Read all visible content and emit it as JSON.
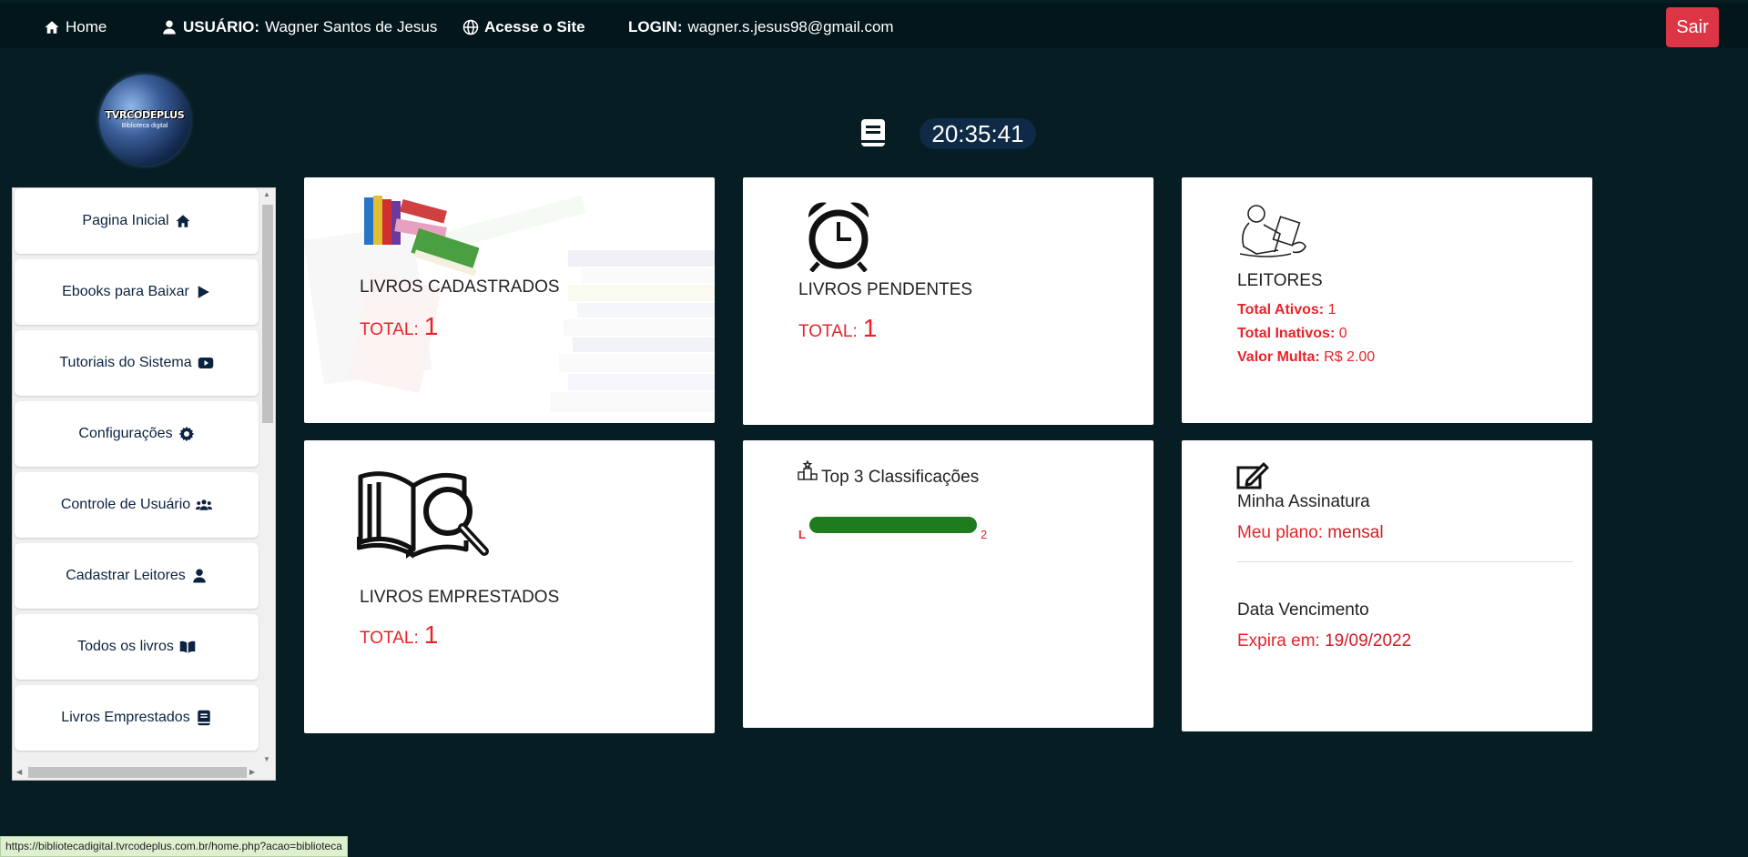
{
  "topbar": {
    "home": "Home",
    "user_label": "USUÁRIO:",
    "user_name": "Wagner Santos de Jesus",
    "site_label": "Acesse o Site",
    "login_label": "LOGIN:",
    "login_email": "wagner.s.jesus98@gmail.com",
    "logout": "Sair"
  },
  "logo": {
    "title": "TVRCODEPLUS",
    "subtitle": "Biblioteca digital"
  },
  "clock": "20:35:41",
  "sidebar": {
    "items": [
      {
        "label": "Pagina Inicial",
        "icon": "home-icon"
      },
      {
        "label": "Ebooks para Baixar",
        "icon": "play-icon"
      },
      {
        "label": "Tutoriais do Sistema",
        "icon": "youtube-icon"
      },
      {
        "label": "Configurações",
        "icon": "gear-icon"
      },
      {
        "label": "Controle de Usuário",
        "icon": "users-icon"
      },
      {
        "label": "Cadastrar Leitores",
        "icon": "user-icon"
      },
      {
        "label": "Todos os livros",
        "icon": "open-book-icon"
      },
      {
        "label": "Livros Emprestados",
        "icon": "book-icon"
      }
    ]
  },
  "cards": {
    "cadastrados": {
      "title": "LIVROS CADASTRADOS",
      "total_label": "TOTAL:",
      "total": "1"
    },
    "pendentes": {
      "title": "LIVROS PENDENTES",
      "total_label": "TOTAL:",
      "total": "1"
    },
    "leitores": {
      "title": "LEITORES",
      "ativos_label": "Total Ativos:",
      "ativos": "1",
      "inativos_label": "Total Inativos:",
      "inativos": "0",
      "multa_label": "Valor Multa:",
      "multa": "R$ 2.00"
    },
    "emprestados": {
      "title": "LIVROS EMPRESTADOS",
      "total_label": "TOTAL:",
      "total": "1"
    },
    "top3": {
      "title": "Top 3 Classificações",
      "bar_label": "L",
      "bar_value": "2",
      "bar_color": "#1e7b1e"
    },
    "assinatura": {
      "title": "Minha Assinatura",
      "plano_label": "Meu plano:",
      "plano": "mensal",
      "venc_title": "Data Vencimento",
      "expira_label": "Expira em:",
      "expira": "19/09/2022"
    }
  },
  "statusbar": "https://bibliotecadigital.tvrcodeplus.com.br/home.php?acao=biblioteca"
}
